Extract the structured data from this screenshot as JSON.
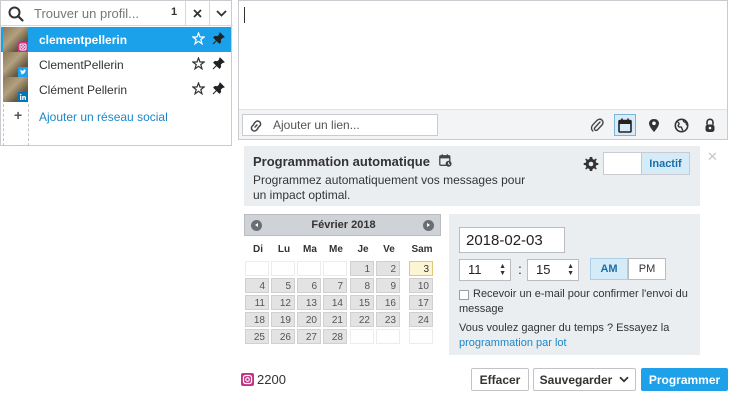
{
  "picker": {
    "search_placeholder": "Trouver un profil...",
    "selected_count": "1",
    "profiles": [
      {
        "name": "clementpellerin",
        "network": "instagram",
        "selected": true
      },
      {
        "name": "ClementPellerin",
        "network": "twitter",
        "selected": false
      },
      {
        "name": "Clément Pellerin",
        "network": "linkedin",
        "selected": false
      }
    ],
    "add_network_label": "Ajouter un réseau social"
  },
  "composer": {
    "message_text": "",
    "link_placeholder": "Ajouter un lien...",
    "tools": [
      "paperclip-icon",
      "calendar-icon",
      "location-pin-icon",
      "globe-icon",
      "lock-icon"
    ],
    "active_tool": "calendar-icon"
  },
  "auto_schedule": {
    "title": "Programmation automatique",
    "description": "Programmez automatiquement vos messages pour un impact optimal.",
    "toggle_label": "Inactif"
  },
  "calendar": {
    "month_label": "Février 2018",
    "weekdays": [
      "Di",
      "Lu",
      "Ma",
      "Me",
      "Je",
      "Ve",
      "Sam"
    ],
    "leading_blanks": 4,
    "days_in_month": 28,
    "today": 3
  },
  "schedule": {
    "date": "2018-02-03",
    "hour": "11",
    "minute": "15",
    "colon": ":",
    "am_label": "AM",
    "pm_label": "PM",
    "period": "AM",
    "email_label": "Recevoir un e-mail pour confirmer l'envoi du message",
    "email_checked": false,
    "bulk_prefix": "Vous voulez gagner du temps ? Essayez la ",
    "bulk_link": "programmation par lot"
  },
  "footer": {
    "char_count": "2200",
    "clear_label": "Effacer",
    "save_label": "Sauvegarder",
    "schedule_label": "Programmer"
  },
  "colors": {
    "accent": "#1ea1e8",
    "selected_row": "#1aa1ea",
    "instagram": "#c13584",
    "twitter": "#1da1f2",
    "linkedin": "#0077b5",
    "panel_bg": "#ebeef1"
  }
}
